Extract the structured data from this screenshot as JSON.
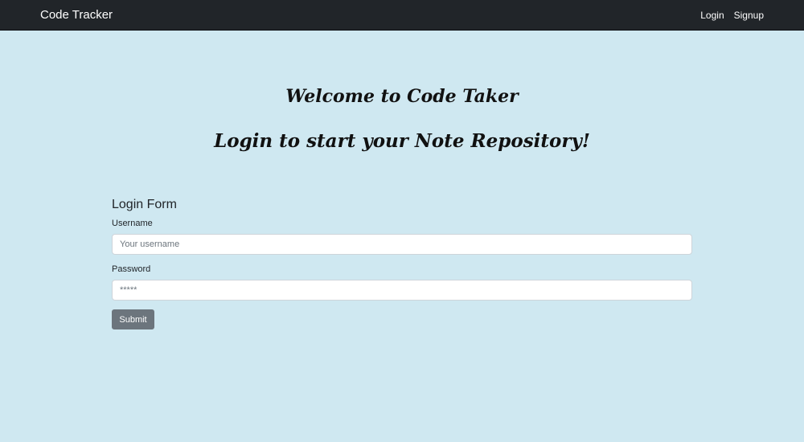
{
  "navbar": {
    "brand": "Code Tracker",
    "links": [
      {
        "label": "Login"
      },
      {
        "label": "Signup"
      }
    ]
  },
  "hero": {
    "welcome": "Welcome to Code Taker",
    "tagline": "Login to start your Note Repository!"
  },
  "form": {
    "title": "Login Form",
    "username": {
      "label": "Username",
      "placeholder": "Your username",
      "value": ""
    },
    "password": {
      "label": "Password",
      "placeholder": "*****",
      "value": ""
    },
    "submit_label": "Submit"
  },
  "colors": {
    "background": "#cfe8f1",
    "navbar": "#212529",
    "submit_button": "#6c757d"
  }
}
